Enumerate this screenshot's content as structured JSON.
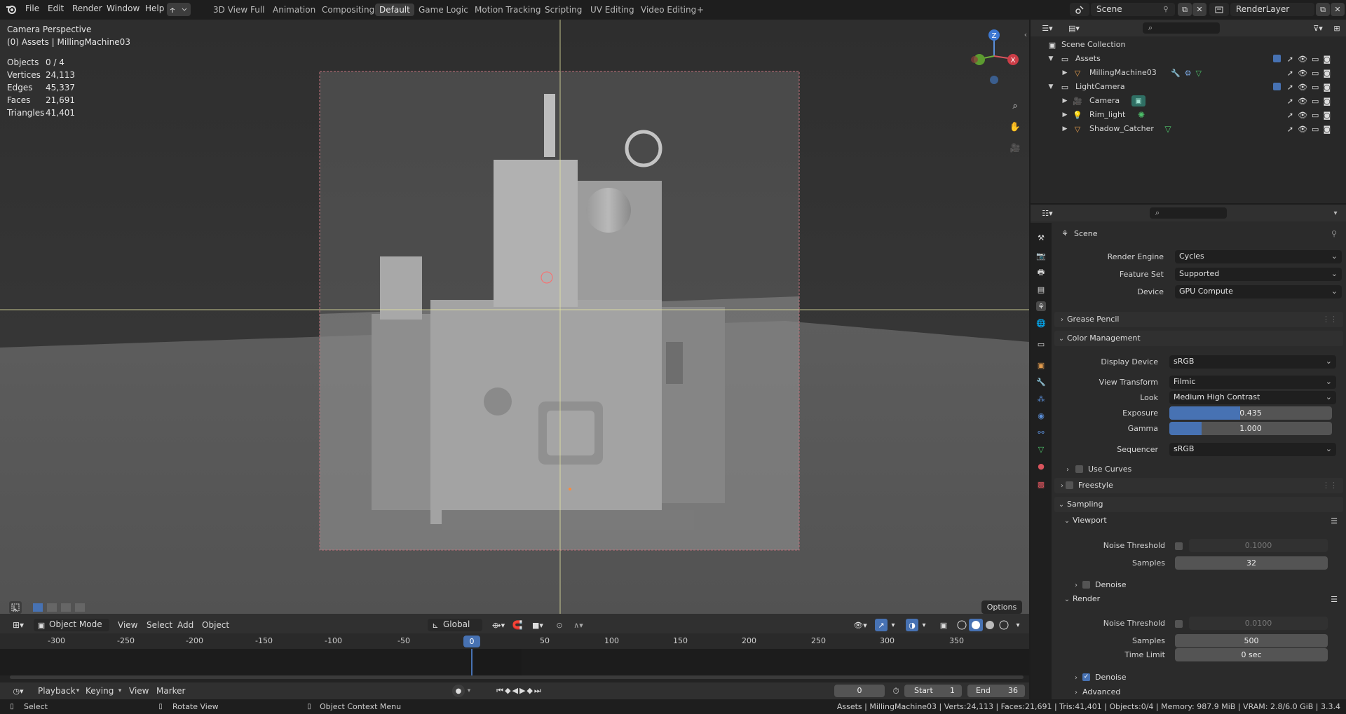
{
  "topbar": {
    "menus": [
      "File",
      "Edit",
      "Render",
      "Window",
      "Help"
    ],
    "workspaces": [
      "3D View Full",
      "Animation",
      "Compositing",
      "Default",
      "Game Logic",
      "Motion Tracking",
      "Scripting",
      "UV Editing",
      "Video Editing"
    ],
    "active_workspace": "Default",
    "add_tab": "+",
    "scene": "Scene",
    "view_layer": "RenderLayer"
  },
  "viewport": {
    "camera_title": "Camera Perspective",
    "collection_info": "(0) Assets | MillingMachine03",
    "stats": [
      {
        "label": "Objects",
        "value": "0 / 4"
      },
      {
        "label": "Vertices",
        "value": "24,113"
      },
      {
        "label": "Edges",
        "value": "45,337"
      },
      {
        "label": "Faces",
        "value": "21,691"
      },
      {
        "label": "Triangles",
        "value": "41,401"
      }
    ],
    "gizmo": {
      "z": "Z",
      "x": "X"
    },
    "options_label": "Options",
    "header": {
      "mode": "Object Mode",
      "menus": [
        "View",
        "Select",
        "Add",
        "Object"
      ],
      "transform_orientation": "Global"
    }
  },
  "timeline": {
    "ticks": [
      "-300",
      "-250",
      "-200",
      "-150",
      "-100",
      "-50",
      "0",
      "50",
      "100",
      "150",
      "200",
      "250",
      "300",
      "350"
    ],
    "current_frame": "0",
    "menus": [
      "Playback",
      "Keying",
      "View",
      "Marker"
    ],
    "frame_field": "0",
    "start_label": "Start",
    "start_value": "1",
    "end_label": "End",
    "end_value": "36"
  },
  "statusbar": {
    "select": "Select",
    "rotate": "Rotate View",
    "context": "Object Context Menu",
    "info": "Assets | MillingMachine03 | Verts:24,113 | Faces:21,691 | Tris:41,401 | Objects:0/4 | Memory: 987.9 MiB | VRAM: 2.8/6.0 GiB | 3.3.4"
  },
  "outliner": {
    "root": "Scene Collection",
    "rows": [
      {
        "label": "Assets",
        "level": 1,
        "kind": "collection"
      },
      {
        "label": "MillingMachine03",
        "level": 2,
        "kind": "mesh"
      },
      {
        "label": "LightCamera",
        "level": 1,
        "kind": "collection"
      },
      {
        "label": "Camera",
        "level": 2,
        "kind": "camera"
      },
      {
        "label": "Rim_light",
        "level": 2,
        "kind": "light"
      },
      {
        "label": "Shadow_Catcher",
        "level": 2,
        "kind": "mesh"
      }
    ]
  },
  "properties": {
    "context": "Scene",
    "render_engine_label": "Render Engine",
    "render_engine": "Cycles",
    "feature_set_label": "Feature Set",
    "feature_set": "Supported",
    "device_label": "Device",
    "device": "GPU Compute",
    "grease_pencil": "Grease Pencil",
    "color_management": "Color Management",
    "display_device_label": "Display Device",
    "display_device": "sRGB",
    "view_transform_label": "View Transform",
    "view_transform": "Filmic",
    "look_label": "Look",
    "look": "Medium High Contrast",
    "exposure_label": "Exposure",
    "exposure": "0.435",
    "exposure_fill": 0.435,
    "gamma_label": "Gamma",
    "gamma": "1.000",
    "gamma_fill": 0.2,
    "sequencer_label": "Sequencer",
    "sequencer": "sRGB",
    "use_curves": "Use Curves",
    "freestyle": "Freestyle",
    "sampling": "Sampling",
    "viewport": "Viewport",
    "noise_threshold_label": "Noise Threshold",
    "viewport_noise": "0.1000",
    "samples_label": "Samples",
    "viewport_samples": "32",
    "denoise_label": "Denoise",
    "render": "Render",
    "render_noise": "0.0100",
    "render_samples": "500",
    "time_limit_label": "Time Limit",
    "time_limit": "0 sec",
    "advanced": "Advanced"
  },
  "colors": {
    "accent": "#4772b3",
    "active_frame": "#4772b3",
    "camera_frame": "#c0707a",
    "crosshair": "#e6e6a0"
  }
}
